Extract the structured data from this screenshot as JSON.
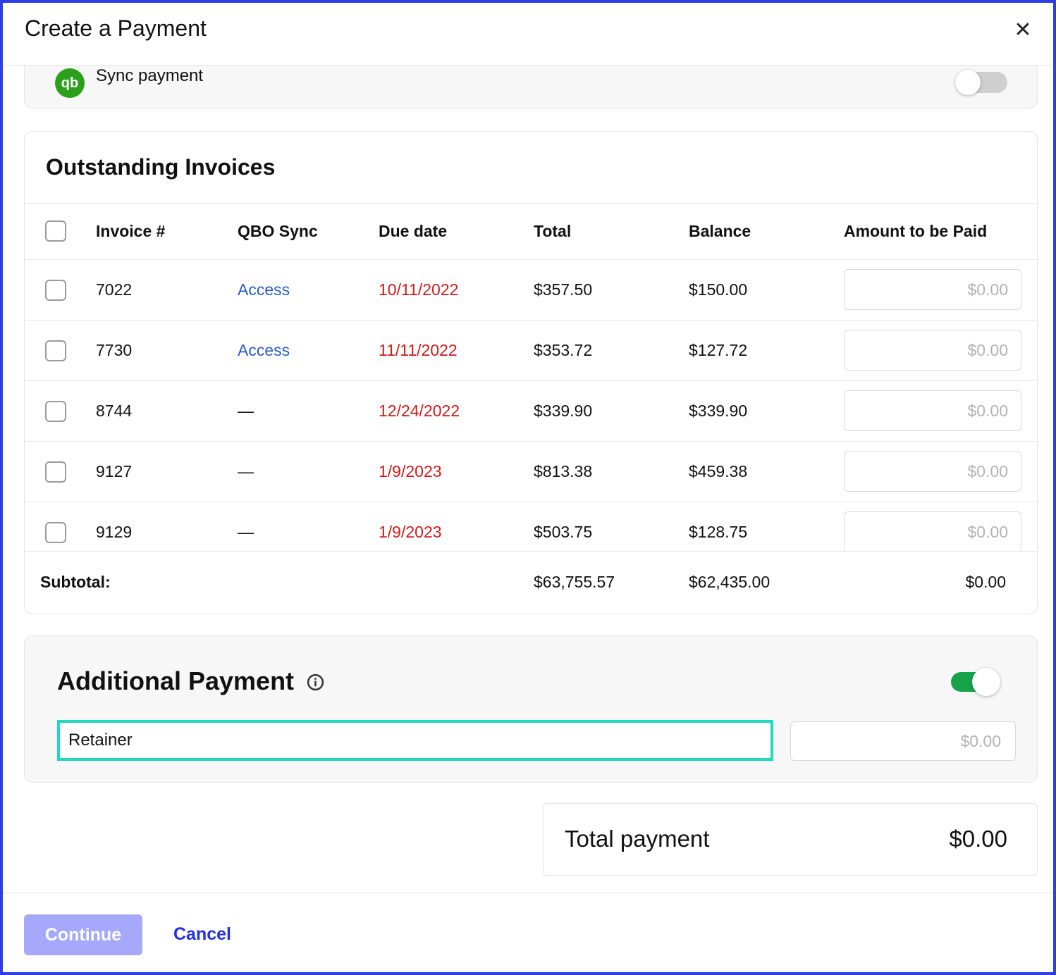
{
  "modal": {
    "title": "Create a Payment",
    "close_glyph": "✕"
  },
  "sync": {
    "logo_text": "qb",
    "label": "Sync payment",
    "enabled": false
  },
  "invoices": {
    "title": "Outstanding Invoices",
    "columns": [
      "Invoice #",
      "QBO Sync",
      "Due date",
      "Total",
      "Balance",
      "Amount to be Paid"
    ],
    "rows": [
      {
        "invoice": "7022",
        "qbo": "Access",
        "due": "10/11/2022",
        "total": "$357.50",
        "balance": "$150.00",
        "amount_placeholder": "$0.00"
      },
      {
        "invoice": "7730",
        "qbo": "Access",
        "due": "11/11/2022",
        "total": "$353.72",
        "balance": "$127.72",
        "amount_placeholder": "$0.00"
      },
      {
        "invoice": "8744",
        "qbo": "—",
        "due": "12/24/2022",
        "total": "$339.90",
        "balance": "$339.90",
        "amount_placeholder": "$0.00"
      },
      {
        "invoice": "9127",
        "qbo": "—",
        "due": "1/9/2023",
        "total": "$813.38",
        "balance": "$459.38",
        "amount_placeholder": "$0.00"
      },
      {
        "invoice": "9129",
        "qbo": "—",
        "due": "1/9/2023",
        "total": "$503.75",
        "balance": "$128.75",
        "amount_placeholder": "$0.00"
      }
    ],
    "subtotal": {
      "label": "Subtotal:",
      "total": "$63,755.57",
      "balance": "$62,435.00",
      "amount": "$0.00"
    }
  },
  "additional_payment": {
    "title": "Additional Payment",
    "enabled": true,
    "description_value": "Retainer",
    "amount_placeholder": "$0.00"
  },
  "total_payment": {
    "label": "Total payment",
    "value": "$0.00"
  },
  "footer": {
    "continue_label": "Continue",
    "cancel_label": "Cancel"
  },
  "colors": {
    "accent_border": "#2d3fe3",
    "link": "#2b5cc4",
    "overdue": "#d11a1a",
    "toggle_on": "#17a34a",
    "focus_ring": "#1fd9c0",
    "continue_disabled": "#a6a9fb",
    "cancel": "#2330e0"
  }
}
